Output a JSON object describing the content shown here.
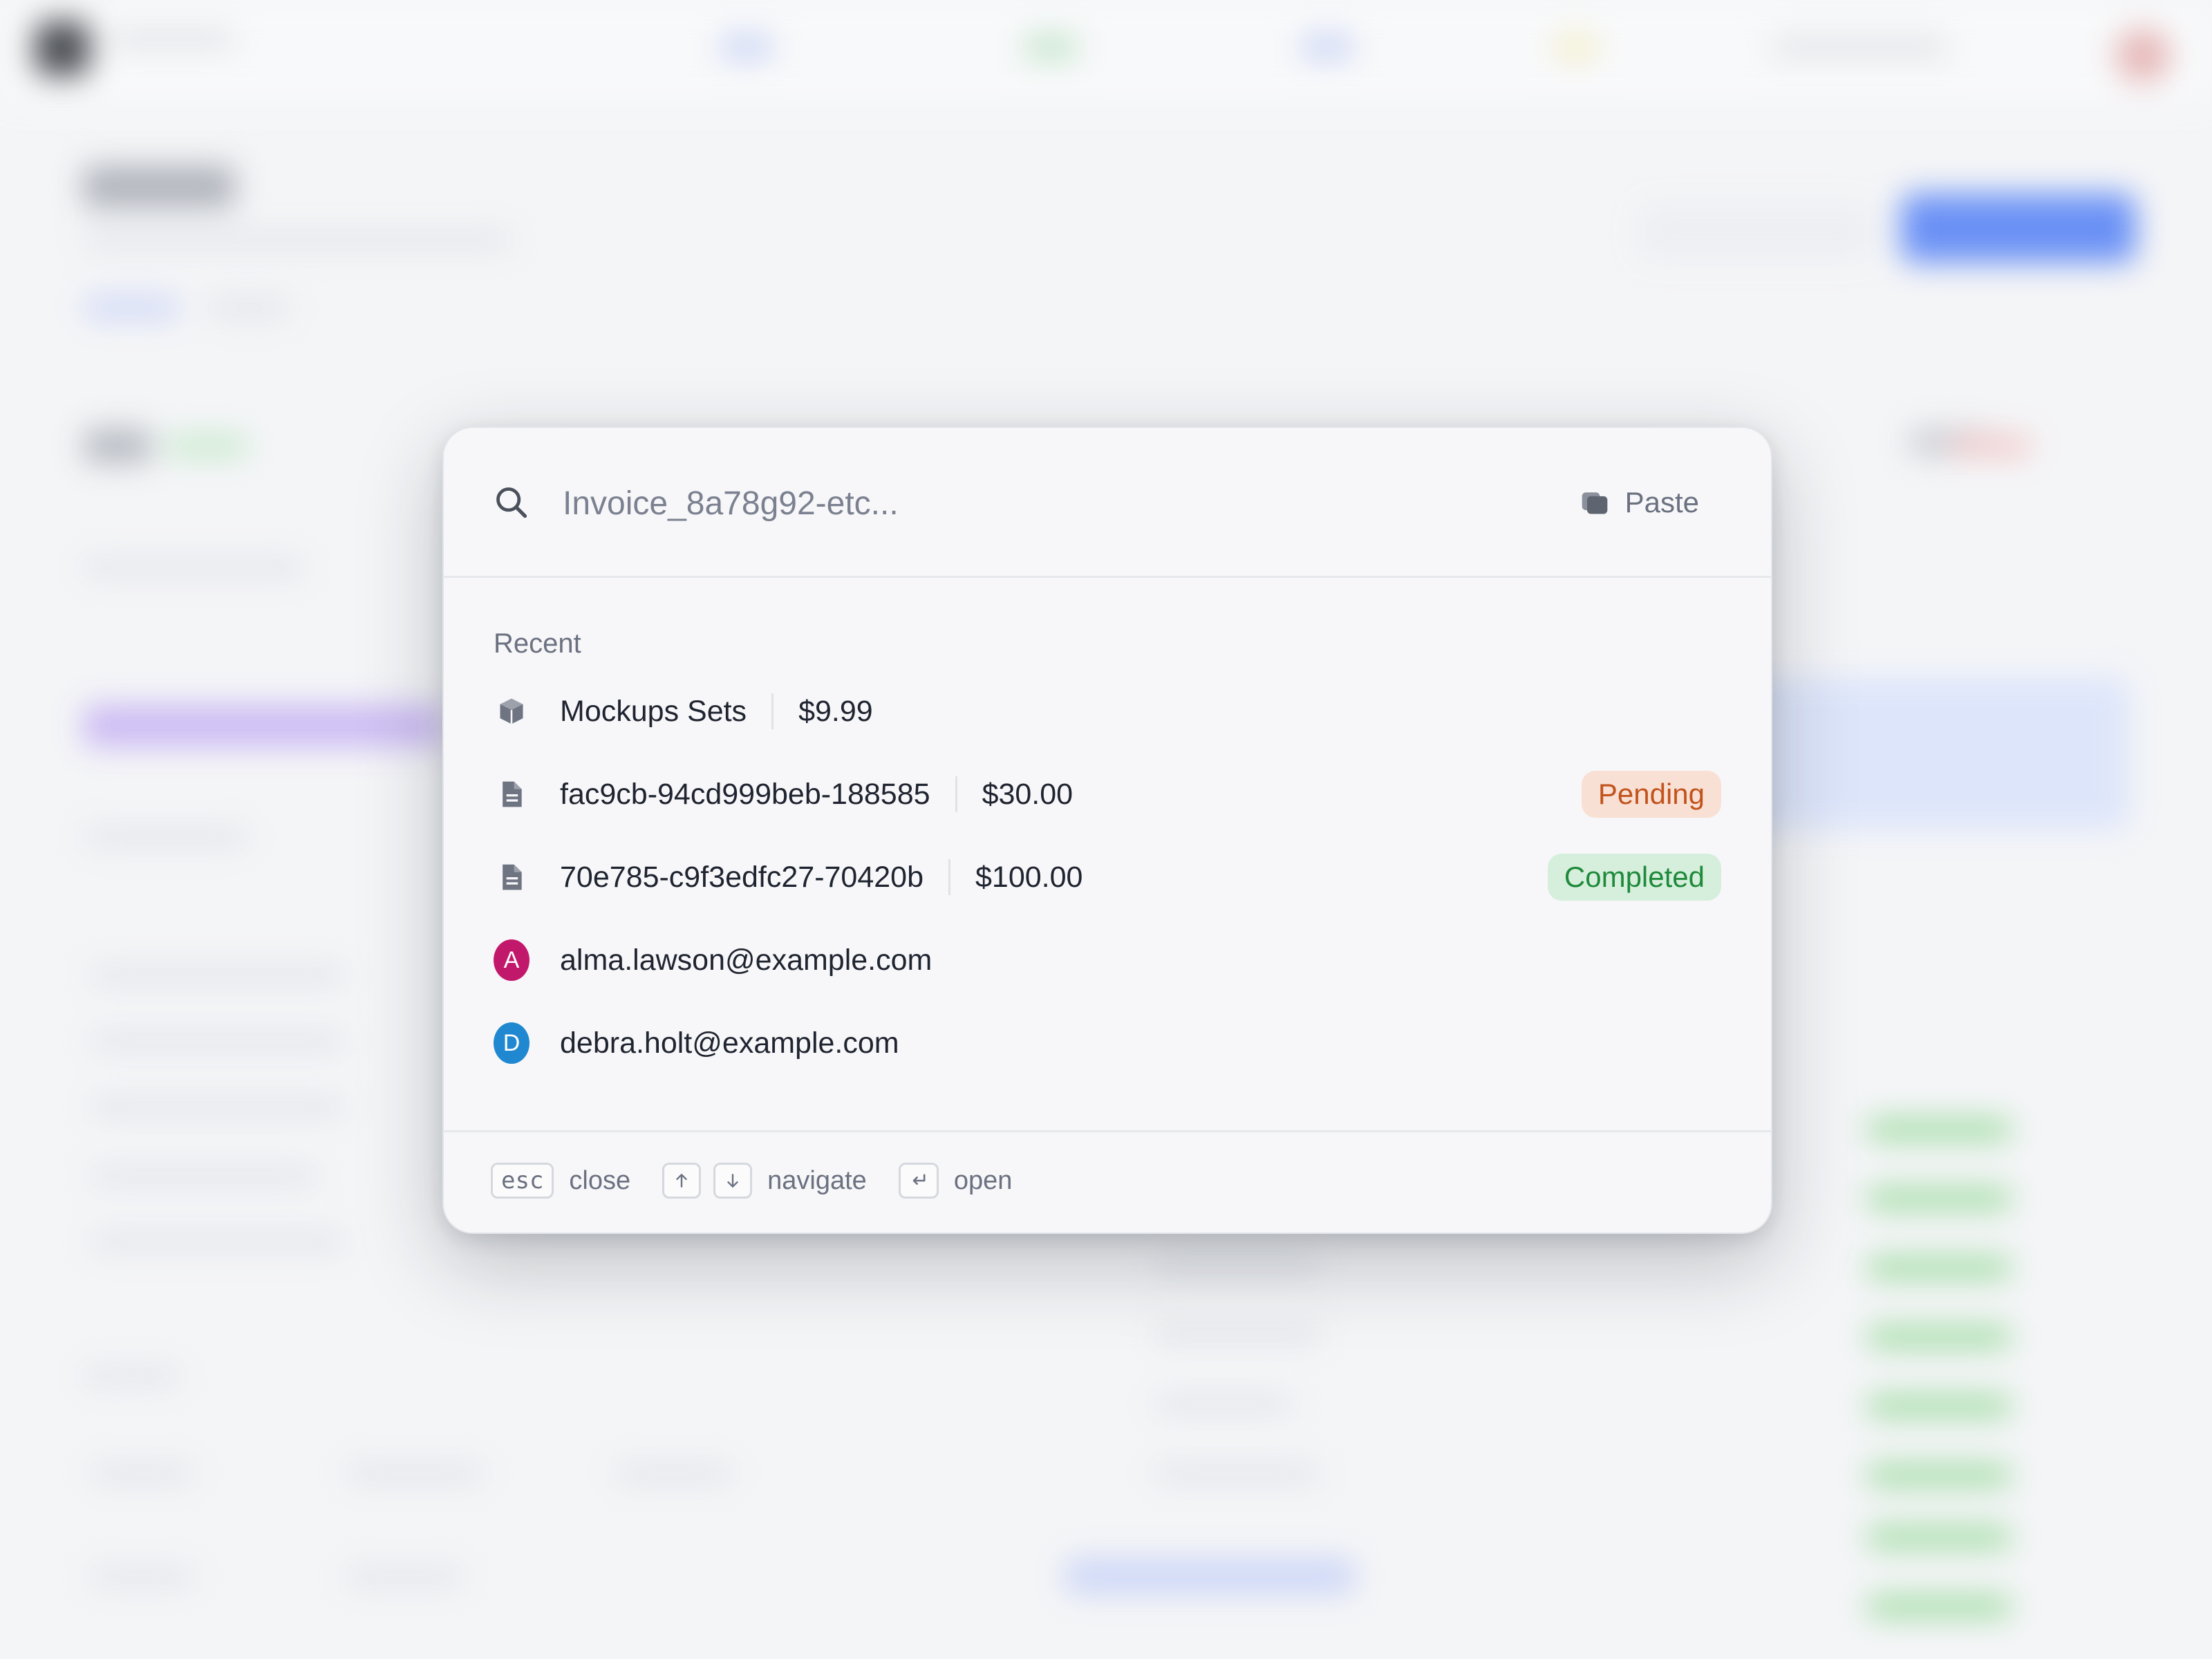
{
  "search": {
    "placeholder": "Invoice_8a78g92-etc...",
    "paste_label": "Paste"
  },
  "recent": {
    "title": "Recent",
    "items": [
      {
        "icon": "box-icon",
        "name": "Mockups Sets",
        "amount": "$9.99",
        "status": ""
      },
      {
        "icon": "document-icon",
        "name": "fac9cb-94cd999beb-188585",
        "amount": "$30.00",
        "status": "Pending"
      },
      {
        "icon": "document-icon",
        "name": "70e785-c9f3edfc27-70420b",
        "amount": "$100.00",
        "status": "Completed"
      },
      {
        "icon": "avatar",
        "initial": "A",
        "name": "alma.lawson@example.com",
        "color": "#c2186b"
      },
      {
        "icon": "avatar",
        "initial": "D",
        "name": "debra.holt@example.com",
        "color": "#1f88d0"
      }
    ]
  },
  "footer": {
    "esc_key": "esc",
    "close_label": "close",
    "navigate_label": "navigate",
    "open_label": "open"
  },
  "colors": {
    "pending_bg": "#f9e0d4",
    "pending_text": "#c2531d",
    "completed_bg": "#d6efdd",
    "completed_text": "#1f8a3a"
  }
}
